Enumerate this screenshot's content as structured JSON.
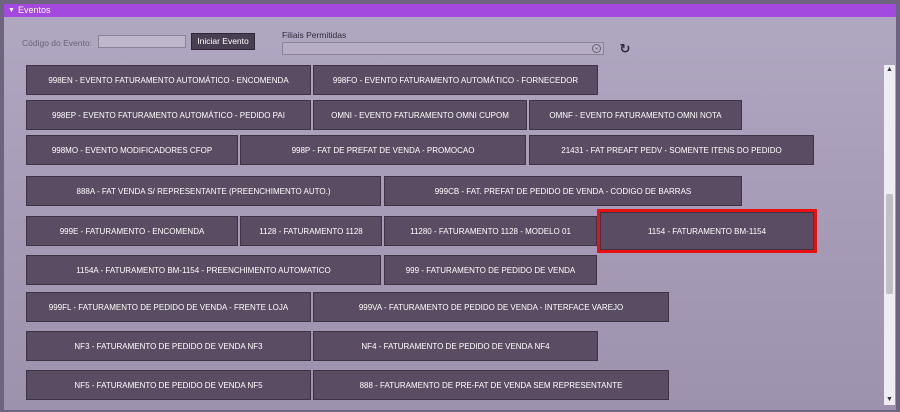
{
  "window": {
    "title": "Eventos"
  },
  "form": {
    "codigo_label": "Código do Evento:",
    "codigo_value": "",
    "iniciar_label": "Iniciar Evento",
    "filiais_label": "Filiais Permitidas",
    "filiais_value": ""
  },
  "events": [
    "998EN - EVENTO FATURAMENTO AUTOMÁTICO - ENCOMENDA",
    "998FO - EVENTO FATURAMENTO AUTOMÁTICO - FORNECEDOR",
    "998EP - EVENTO FATURAMENTO AUTOMÁTICO - PEDIDO PAI",
    "OMNI - EVENTO FATURAMENTO OMNI CUPOM",
    "OMNF - EVENTO FATURAMENTO OMNI NOTA",
    "998MO - EVENTO MODIFICADORES CFOP",
    "998P - FAT DE PREFAT DE VENDA - PROMOCAO",
    "21431 - FAT PREAFT PEDV - SOMENTE ITENS DO PEDIDO",
    "888A - FAT VENDA S/ REPRESENTANTE (PREENCHIMENTO AUTO.)",
    "999CB - FAT. PREFAT DE PEDIDO DE VENDA - CODIGO DE BARRAS",
    "999E - FATURAMENTO - ENCOMENDA",
    "1128 - FATURAMENTO 1128",
    "11280 - FATURAMENTO 1128 - MODELO 01",
    "1154 - FATURAMENTO BM-1154",
    "1154A - FATURAMENTO BM-1154 - PREENCHIMENTO AUTOMATICO",
    "999 - FATURAMENTO DE PEDIDO DE VENDA",
    "999FL - FATURAMENTO DE PEDIDO DE VENDA - FRENTE LOJA",
    "999VA - FATURAMENTO DE PEDIDO DE VENDA - INTERFACE VAREJO",
    "NF3 - FATURAMENTO DE PEDIDO DE VENDA NF3",
    "NF4 - FATURAMENTO DE PEDIDO DE VENDA NF4",
    "NF5 - FATURAMENTO DE PEDIDO DE VENDA NF5",
    "888 - FATURAMENTO DE PRE-FAT DE VENDA SEM REPRESENTANTE"
  ],
  "highlighted_event": "1154 - FATURAMENTO BM-1154",
  "colors": {
    "title_bar": "#a349e0",
    "button_bg": "#5a4d63",
    "highlight_border": "#e81010"
  }
}
